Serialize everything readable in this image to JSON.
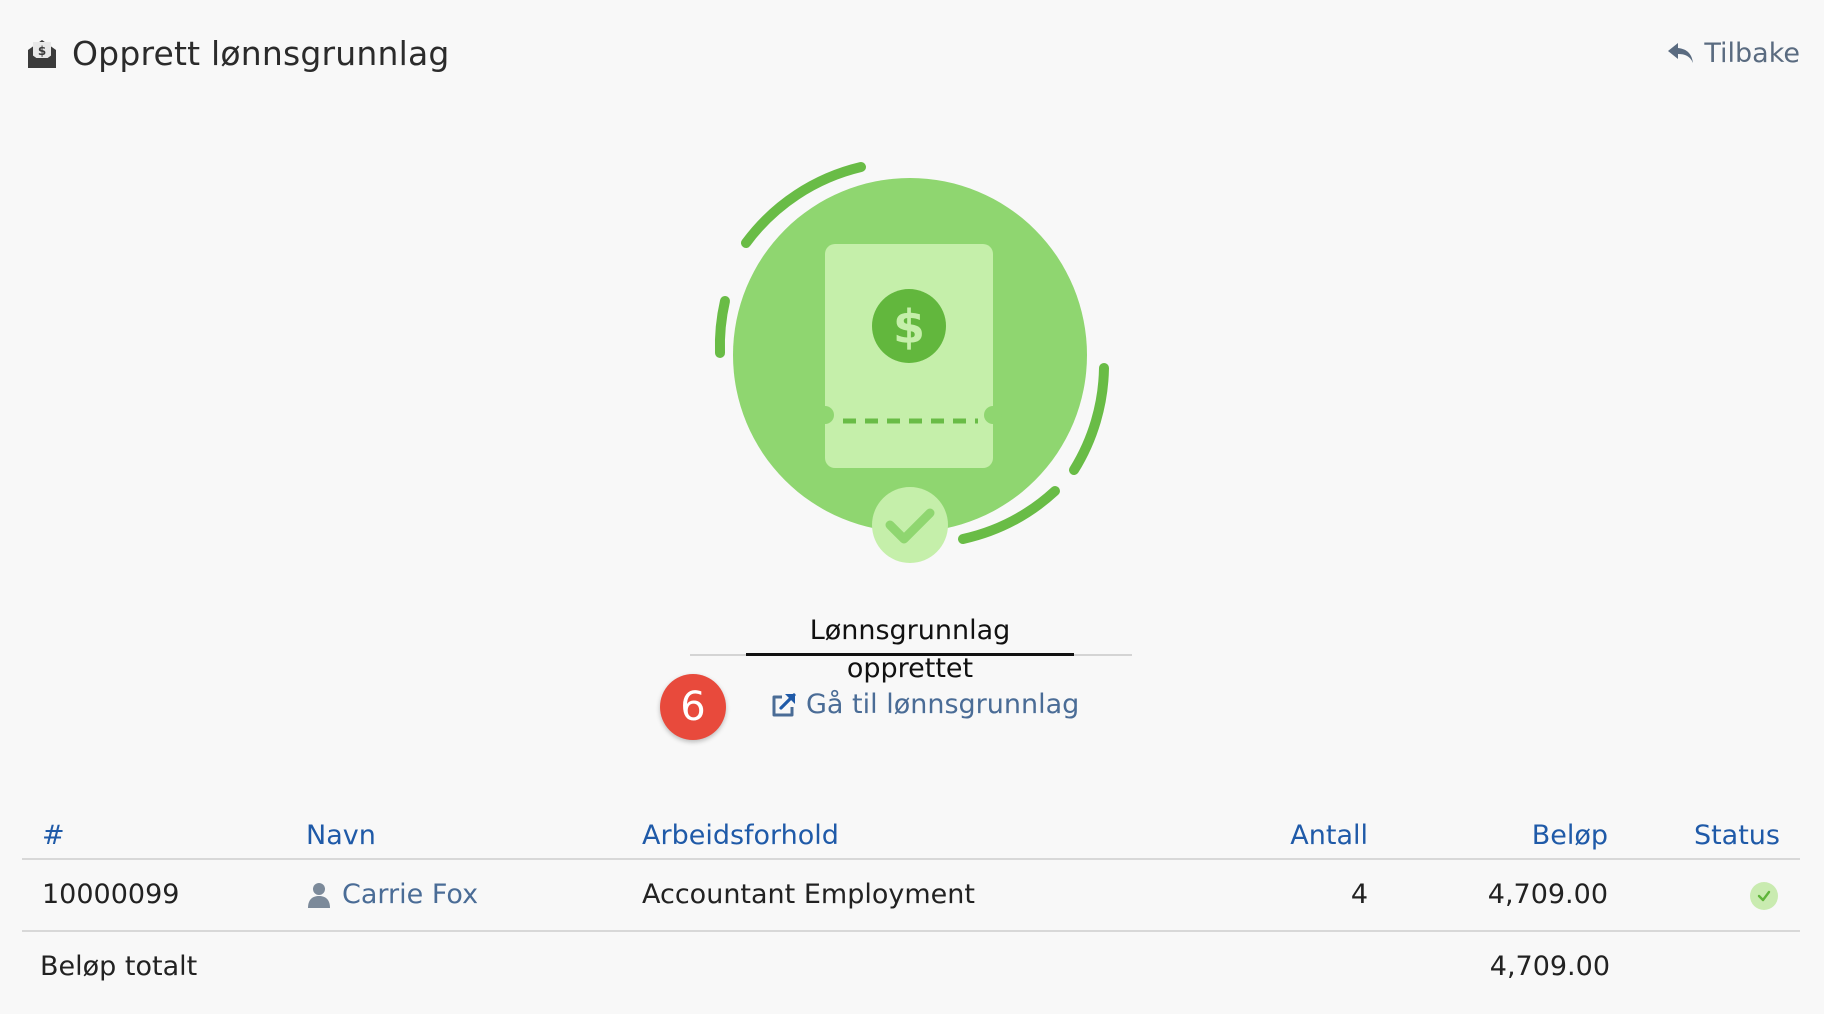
{
  "header": {
    "title": "Opprett lønnsgrunnlag",
    "icon": "money-envelope-icon",
    "back_label": "Tilbake",
    "back_icon": "reply-arrow-icon"
  },
  "success": {
    "title": "Lønnsgrunnlag opprettet",
    "illustration": "payslip-success-icon"
  },
  "step_badge": "6",
  "goto_link": {
    "label": "Gå til lønnsgrunnlag",
    "icon": "external-link-icon"
  },
  "table": {
    "headers": [
      "#",
      "Navn",
      "Arbeidsforhold",
      "Antall",
      "Beløp",
      "Status"
    ],
    "rows": [
      {
        "id": "10000099",
        "name": "Carrie Fox",
        "employment": "Accountant Employment",
        "count": "4",
        "amount": "4,709.00",
        "status": "ok"
      }
    ],
    "total_label": "Beløp totalt",
    "total_amount": "4,709.00"
  },
  "colors": {
    "accent": "#1f5aa8",
    "link": "#4a6c96",
    "success_green": "#6dbf45",
    "badge_red": "#e84a3c"
  }
}
